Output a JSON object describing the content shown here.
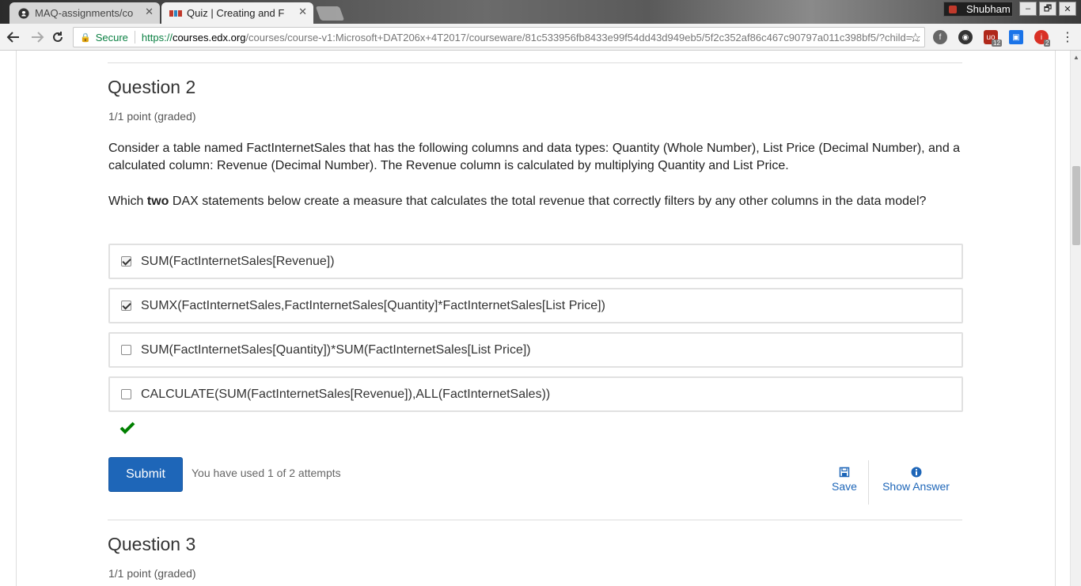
{
  "browser": {
    "tabs": [
      {
        "title": "MAQ-assignments/co",
        "icon": "github-icon",
        "active": false
      },
      {
        "title": "Quiz | Creating and F",
        "icon": "edx-icon",
        "active": true
      }
    ],
    "profile_name": "Shubham",
    "window_controls": {
      "minimize": "–",
      "restore": "🗗",
      "close": "✕"
    },
    "address": {
      "secure_label": "Secure",
      "scheme": "https://",
      "host": "courses.edx.org",
      "path": "/courses/course-v1:Microsoft+DAT206x+4T2017/courseware/81c533956fb8433e99f54dd43d949eb5/5f2c352af86c467c90797a011c398bf5/?child=..."
    },
    "extensions": [
      {
        "name": "feedly-icon",
        "label": "f",
        "color": "#555555"
      },
      {
        "name": "speed-dial-icon",
        "label": "◉",
        "color": "#333333"
      },
      {
        "name": "ublock-icon",
        "label": "uo",
        "color": "#b0281a",
        "badge": "12"
      },
      {
        "name": "screenshot-icon",
        "label": "▣",
        "color": "#1a73e8"
      },
      {
        "name": "opera-icon",
        "label": "i",
        "color": "#d93025",
        "badge": "2"
      }
    ]
  },
  "question2": {
    "title": "Question 2",
    "points": "1/1 point (graded)",
    "paragraph1": "Consider a table named FactInternetSales that has the following columns and data types: Quantity (Whole Number), List Price (Decimal Number), and a calculated column: Revenue (Decimal Number). The Revenue column is calculated by multiplying Quantity and List Price.",
    "prompt_prefix": "Which ",
    "prompt_bold": "two",
    "prompt_suffix": " DAX statements below create a measure that calculates the total revenue that correctly filters by any other columns in the data model?",
    "options": [
      {
        "label": "SUM(FactInternetSales[Revenue])",
        "checked": true
      },
      {
        "label": "SUMX(FactInternetSales,FactInternetSales[Quantity]*FactInternetSales[List Price])",
        "checked": true
      },
      {
        "label": "SUM(FactInternetSales[Quantity])*SUM(FactInternetSales[List Price])",
        "checked": false
      },
      {
        "label": "CALCULATE(SUM(FactInternetSales[Revenue]),ALL(FactInternetSales))",
        "checked": false
      }
    ],
    "result": "correct",
    "submit_label": "Submit",
    "attempts_text": "You have used 1 of 2 attempts",
    "save_label": "Save",
    "show_answer_label": "Show Answer"
  },
  "question3": {
    "title": "Question 3",
    "points": "1/1 point (graded)"
  },
  "colors": {
    "link": "#1e66b8",
    "correct": "#008000",
    "secure": "#0b8043"
  }
}
